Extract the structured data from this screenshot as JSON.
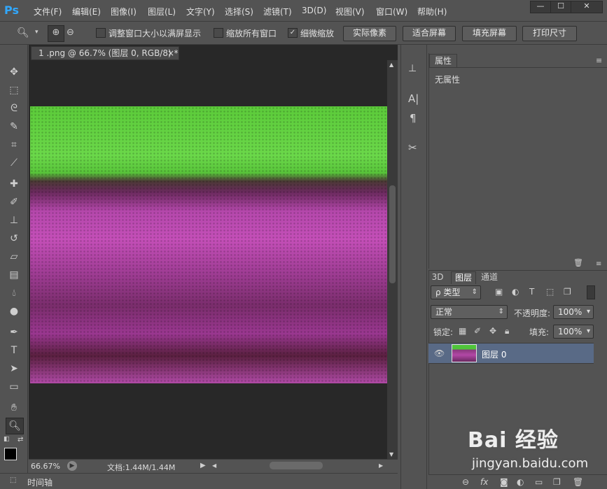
{
  "app": {
    "logo": "Ps"
  },
  "menu": [
    "文件(F)",
    "编辑(E)",
    "图像(I)",
    "图层(L)",
    "文字(Y)",
    "选择(S)",
    "滤镜(T)",
    "3D(D)",
    "视图(V)",
    "窗口(W)",
    "帮助(H)"
  ],
  "window_controls": {
    "minimize": "—",
    "maximize": "☐",
    "close": "✕"
  },
  "options": {
    "resize_windows_label": "调整窗口大小以满屏显示",
    "resize_windows_checked": false,
    "zoom_all_label": "缩放所有窗口",
    "zoom_all_checked": false,
    "scrubby_zoom_label": "细微缩放",
    "scrubby_zoom_checked": true,
    "actual_pixels": "实际像素",
    "fit_screen": "适合屏幕",
    "fill_screen": "填充屏幕",
    "print_size": "打印尺寸"
  },
  "document": {
    "tab_title": "1 .png @ 66.7% (图层 0, RGB/8) *",
    "tab_close": "×"
  },
  "status": {
    "zoom": "66.67%",
    "doc_info": "文档:1.44M/1.44M"
  },
  "timeline_label": "时间轴",
  "properties": {
    "tab": "属性",
    "empty_text": "无属性"
  },
  "layers_panel": {
    "tabs": [
      "3D",
      "图层",
      "通道"
    ],
    "active_tab": "图层",
    "filter_label": "ρ 类型",
    "blend_mode": "正常",
    "opacity_label": "不透明度:",
    "opacity_value": "100%",
    "lock_label": "锁定:",
    "fill_label": "填充:",
    "fill_value": "100%",
    "layers": [
      {
        "name": "图层 0",
        "visible": true
      }
    ]
  },
  "watermark": {
    "brand": "Bai 经验",
    "url": "jingyan.baidu.com"
  },
  "colors": {
    "background": "#535353",
    "canvas_bg": "#282828",
    "selected_layer": "#596a86",
    "ps_blue": "#31a8ff"
  }
}
